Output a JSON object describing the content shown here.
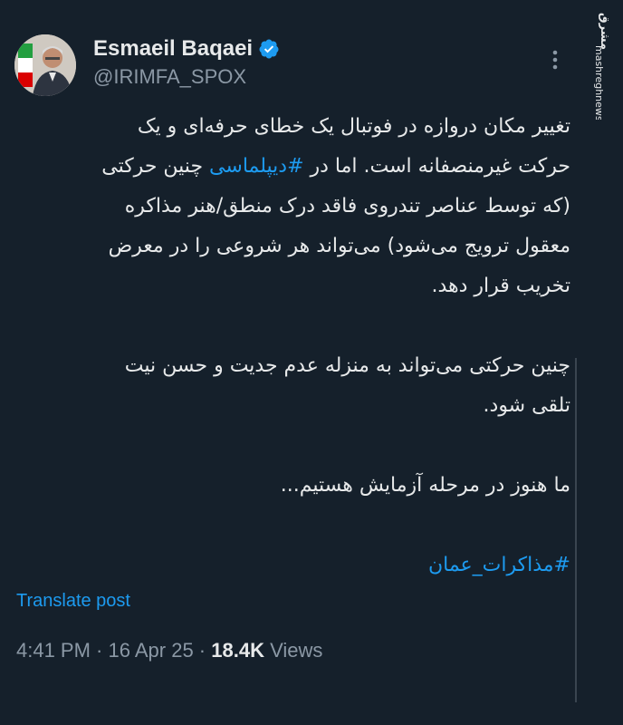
{
  "author": {
    "display_name": "Esmaeil Baqaei",
    "handle": "@IRIMFA_SPOX",
    "verified_icon": "verified-badge-icon",
    "avatar_icon": "profile-avatar"
  },
  "watermark": {
    "site": "mashreghnews.ir",
    "logo_text": "مشرق"
  },
  "more_icon": "more-options-icon",
  "tweet": {
    "p1_l1": "تغییر مکان دروازه در فوتبال یک خطای حرفه‌ای و یک",
    "p1_l2a": "حرکت غیرمنصفانه است. اما در ",
    "p1_l2_hashtag": "#دیپلماسی",
    "p1_l2b": " چنین حرکتی",
    "p1_l3": "(که توسط عناصر تندروی فاقد درک منطق/هنر مذاکره",
    "p1_l4": "معقول ترویج می‌شود) می‌تواند هر شروعی را در معرض",
    "p1_l5": "تخریب قرار دهد.",
    "p2_l1": "چنین حرکتی می‌تواند به منزله عدم جدیت و حسن نیت",
    "p2_l2": "تلقی شود.",
    "p3": "ما هنوز در مرحله آزمایش هستیم...",
    "hashtag2": "#مذاکرات_عمان"
  },
  "translate_label": "Translate post",
  "meta": {
    "time": "4:41 PM",
    "sep1": " · ",
    "date": "16 Apr 25",
    "sep2": " · ",
    "views_count": "18.4K",
    "views_label": " Views"
  },
  "colors": {
    "background": "#15202b",
    "text": "#e7e9ea",
    "secondary": "#8b98a5",
    "accent": "#1d9bf0"
  }
}
